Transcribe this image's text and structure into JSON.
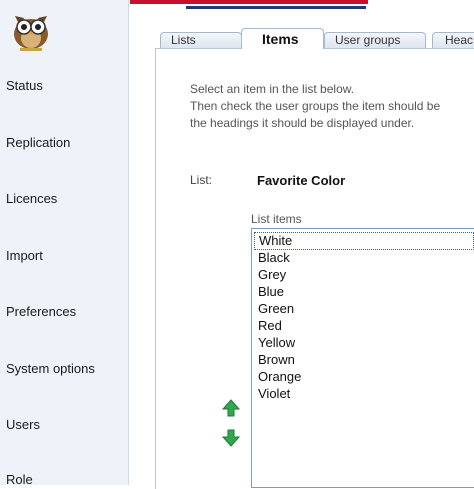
{
  "sidebar": {
    "items": [
      {
        "label": "Status"
      },
      {
        "label": "Replication"
      },
      {
        "label": "Licences"
      },
      {
        "label": "Import"
      },
      {
        "label": "Preferences"
      },
      {
        "label": "System options"
      },
      {
        "label": "Users"
      },
      {
        "label": "Role"
      }
    ]
  },
  "tabs": [
    {
      "label": "Lists",
      "active": false
    },
    {
      "label": "Items",
      "active": true
    },
    {
      "label": "User groups",
      "active": false
    },
    {
      "label": "Heac",
      "active": false
    }
  ],
  "main": {
    "instructions": [
      "Select an item in the list below.",
      "Then check the user groups the item should be",
      "the headings it should be displayed under."
    ],
    "list_label": "List:",
    "list_name": "Favorite Color",
    "items_label": "List items",
    "items": [
      "White",
      "Black",
      "Grey",
      "Blue",
      "Green",
      "Red",
      "Yellow",
      "Brown",
      "Orange",
      "Violet"
    ],
    "selected_item": "White"
  },
  "colors": {
    "accent_red": "#c8102e",
    "accent_blue": "#1f3a7a",
    "arrow_green": "#2fa84f"
  },
  "icons": {
    "logo": "owl-logo",
    "move_up": "arrow-up-icon",
    "move_down": "arrow-down-icon"
  }
}
